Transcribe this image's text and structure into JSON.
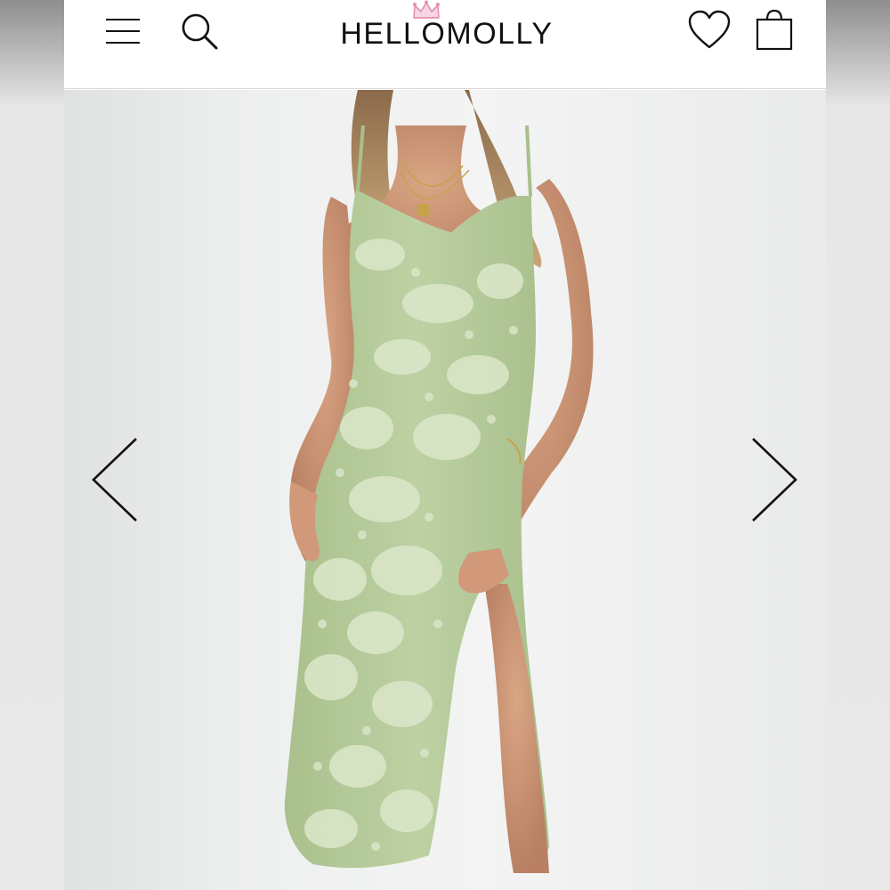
{
  "header": {
    "brand": "HELLOMOLLY",
    "icons": {
      "menu": "hamburger-menu-icon",
      "search": "search-icon",
      "wishlist": "heart-icon",
      "cart": "shopping-bag-icon",
      "logo_mark": "crown-icon"
    }
  },
  "gallery": {
    "image": "model-in-sage-green-floral-midi-dress",
    "prev_icon": "chevron-left-icon",
    "next_icon": "chevron-right-icon"
  },
  "colors": {
    "dress": "#b9cf9e",
    "dress_pattern": "#d9e6c8",
    "crown": "#e58fb2",
    "icon": "#111111"
  }
}
